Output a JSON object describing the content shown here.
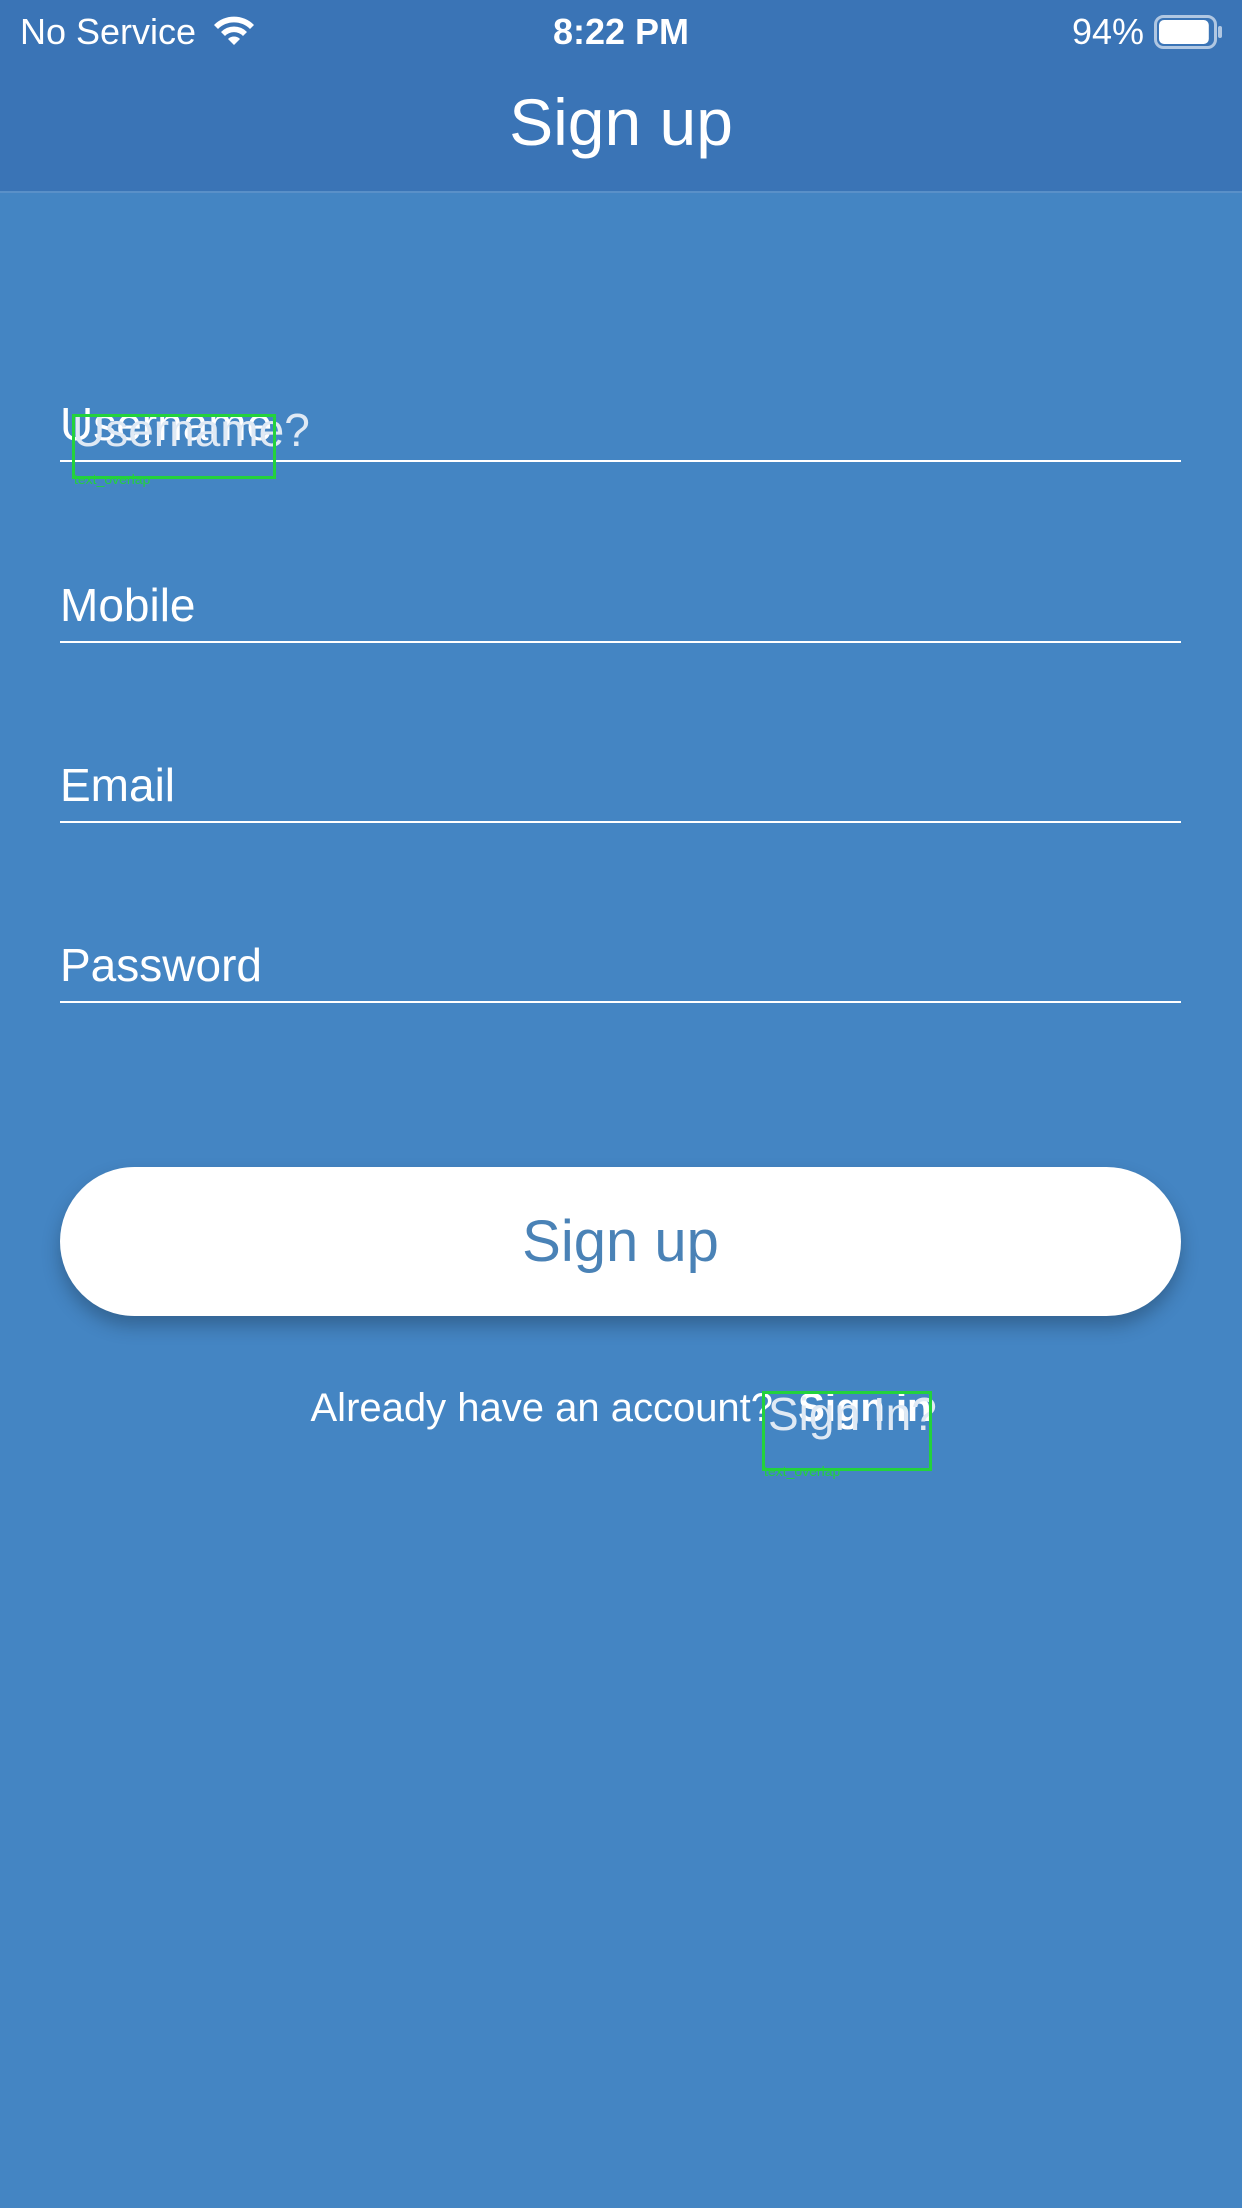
{
  "status_bar": {
    "carrier": "No Service",
    "time": "8:22 PM",
    "battery_percent": "94%",
    "battery_level": 0.94,
    "icons": [
      "wifi-icon",
      "battery-icon"
    ]
  },
  "nav": {
    "title": "Sign up"
  },
  "form": {
    "username_placeholder": "Username",
    "mobile_placeholder": "Mobile",
    "email_placeholder": "Email",
    "password_placeholder": "Password",
    "submit_label": "Sign up"
  },
  "footer": {
    "prompt": "Already have an account?",
    "signin_label": "Sign in"
  },
  "overlay": {
    "username_ghost": "Username?",
    "signin_ghost": "Sign In?",
    "tag": "text_overlap"
  },
  "colors": {
    "background": "#4485c3",
    "header": "#3a74b6",
    "button_bg": "#ffffff",
    "button_text": "#4a82b6",
    "overlap_box": "#23d23c"
  }
}
